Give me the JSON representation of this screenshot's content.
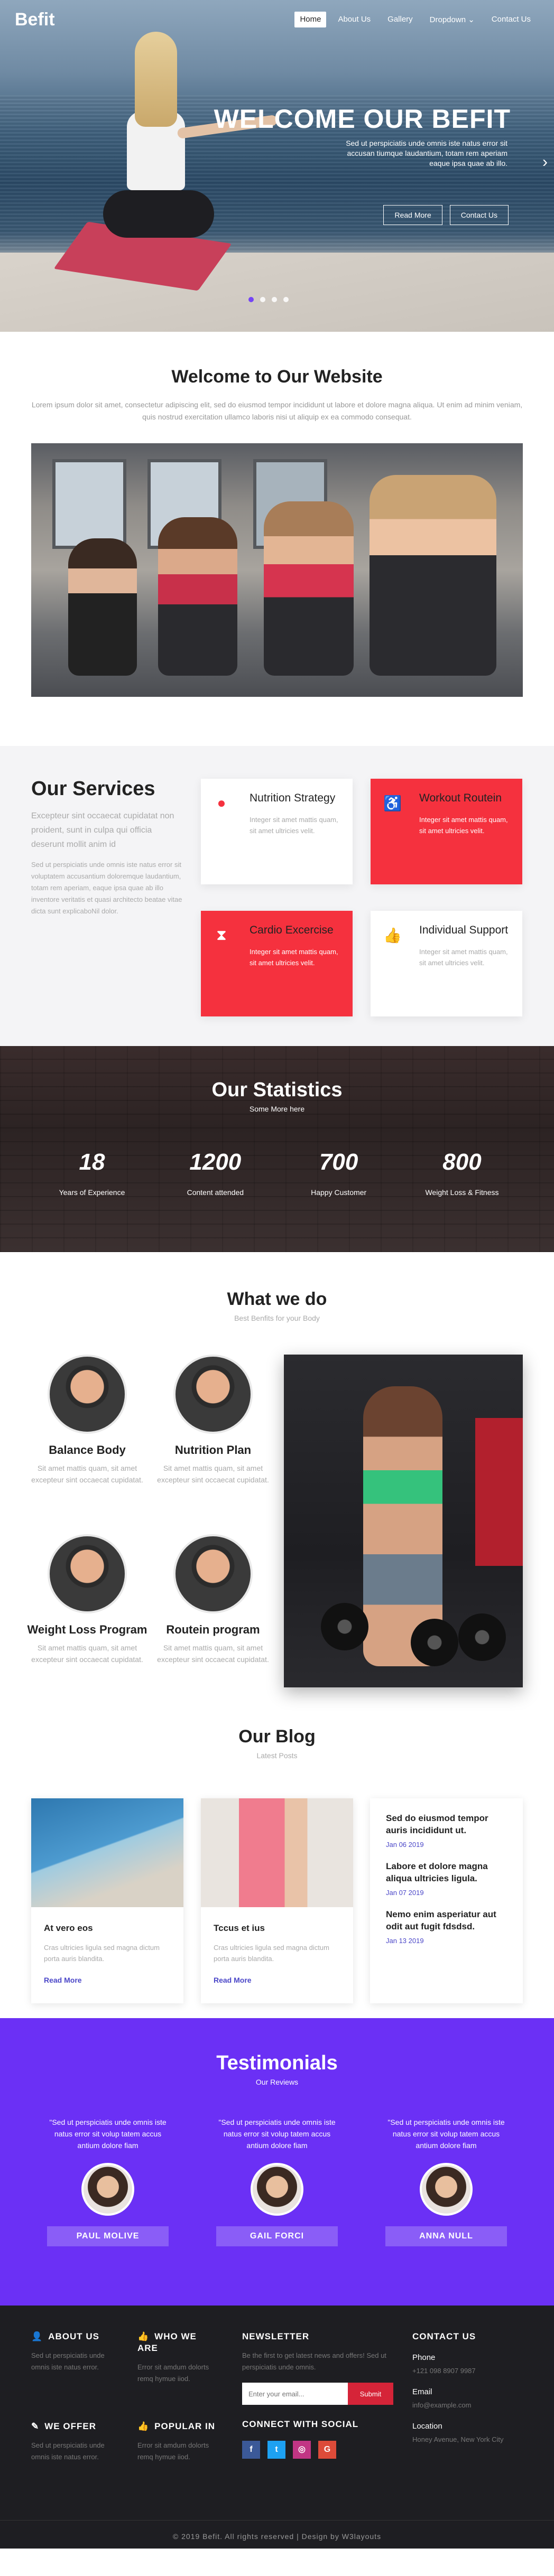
{
  "header": {
    "logo": "Befit",
    "nav": [
      "Home",
      "About Us",
      "Gallery",
      "Dropdown",
      "Contact Us"
    ],
    "dropdown_icon": "chevron-down-icon"
  },
  "hero": {
    "title": "WELCOME OUR BEFIT",
    "text": "Sed ut perspiciatis unde omnis iste natus error sit accusan tiumque laudantium, totam rem aperiam eaque ipsa quae ab illo.",
    "btn1": "Read More",
    "btn2": "Contact Us",
    "arrow_icon": "chevron-right-icon",
    "slides": 4
  },
  "welcome": {
    "title": "Welcome to Our Website",
    "text": "Lorem ipsum dolor sit amet, consectetur adipiscing elit, sed do eiusmod tempor incididunt ut labore et dolore magna aliqua. Ut enim ad minim veniam, quis nostrud exercitation ullamco laboris nisi ut aliquip ex ea commodo consequat."
  },
  "services": {
    "title": "Our Services",
    "lead": "Excepteur sint occaecat cupidatat non proident, sunt in culpa qui officia deserunt mollit anim id",
    "body": "Sed ut perspiciatis unde omnis iste natus error sit voluptatem accusantium doloremque laudantium, totam rem aperiam, eaque ipsa quae ab illo inventore veritatis et quasi architecto beatae vitae dicta sunt explicaboNil dolor.",
    "cards": [
      {
        "title": "Nutrition Strategy",
        "text": "Integer sit amet mattis quam, sit amet ultricies velit.",
        "icon": "apple-icon"
      },
      {
        "title": "Workout Routein",
        "text": "Integer sit amet mattis quam, sit amet ultricies velit.",
        "icon": "wheelchair-icon"
      },
      {
        "title": "Cardio Excercise",
        "text": "Integer sit amet mattis quam, sit amet ultricies velit.",
        "icon": "hourglass-icon"
      },
      {
        "title": "Individual Support",
        "text": "Integer sit amet mattis quam, sit amet ultricies velit.",
        "icon": "thumbs-up-icon"
      }
    ]
  },
  "stats": {
    "title": "Our Statistics",
    "sub": "Some More here",
    "items": [
      {
        "num": "18",
        "label": "Years of Experience"
      },
      {
        "num": "1200",
        "label": "Content attended"
      },
      {
        "num": "700",
        "label": "Happy Customer"
      },
      {
        "num": "800",
        "label": "Weight Loss & Fitness"
      }
    ]
  },
  "what": {
    "title": "What we do",
    "sub": "Best Benfits for your Body",
    "items": [
      {
        "title": "Balance Body",
        "text": "Sit amet mattis quam, sit amet excepteur sint occaecat cupidatat."
      },
      {
        "title": "Nutrition Plan",
        "text": "Sit amet mattis quam, sit amet excepteur sint occaecat cupidatat."
      },
      {
        "title": "Weight Loss Program",
        "text": "Sit amet mattis quam, sit amet excepteur sint occaecat cupidatat."
      },
      {
        "title": "Routein program",
        "text": "Sit amet mattis quam, sit amet excepteur sint occaecat cupidatat."
      }
    ]
  },
  "blog": {
    "title": "Our Blog",
    "sub": "Latest Posts",
    "cards": [
      {
        "title": "At vero eos",
        "text": "Cras ultricies ligula sed magna dictum porta auris blandita.",
        "more": "Read More"
      },
      {
        "title": "Tccus et ius",
        "text": "Cras ultricies ligula sed magna dictum porta auris blandita.",
        "more": "Read More"
      }
    ],
    "list": [
      {
        "title": "Sed do eiusmod tempor auris incididunt ut.",
        "date": "Jan 06 2019"
      },
      {
        "title": "Labore et dolore magna aliqua ultricies ligula.",
        "date": "Jan 07 2019"
      },
      {
        "title": "Nemo enim asperiatur aut odit aut fugit fdsdsd.",
        "date": "Jan 13 2019"
      }
    ]
  },
  "testimonials": {
    "title": "Testimonials",
    "sub": "Our Reviews",
    "items": [
      {
        "quote": "\"Sed ut perspiciatis unde omnis iste natus error sit volup tatem accus antium dolore fiam",
        "name": "PAUL MOLIVE"
      },
      {
        "quote": "\"Sed ut perspiciatis unde omnis iste natus error sit volup tatem accus antium dolore fiam",
        "name": "GAIL FORCI"
      },
      {
        "quote": "\"Sed ut perspiciatis unde omnis iste natus error sit volup tatem accus antium dolore fiam",
        "name": "ANNA NULL"
      }
    ]
  },
  "footer": {
    "about": {
      "title": "ABOUT US",
      "text": "Sed ut perspiciatis unde omnis iste natus error.",
      "icon": "user-icon"
    },
    "who": {
      "title": "WHO WE ARE",
      "text": "Error sit amdum dolorts remq hymue iiod.",
      "icon": "thumbs-up-icon"
    },
    "offer": {
      "title": "WE OFFER",
      "text": "Sed ut perspiciatis unde omnis iste natus error.",
      "icon": "pencil-icon"
    },
    "popular": {
      "title": "POPULAR IN",
      "text": "Error sit amdum dolorts remq hymue iiod.",
      "icon": "thumbs-up-icon"
    },
    "newsletter": {
      "title": "NEWSLETTER",
      "text": "Be the first to get latest news and offers! Sed ut perspiciatis unde omnis.",
      "placeholder": "Enter your email...",
      "button": "Submit"
    },
    "social_title": "CONNECT WITH SOCIAL",
    "social": [
      {
        "glyph": "f",
        "icon": "facebook-icon",
        "color": "#3b5998"
      },
      {
        "glyph": "t",
        "icon": "twitter-icon",
        "color": "#1da1f2"
      },
      {
        "glyph": "◎",
        "icon": "instagram-icon",
        "color": "#c13584"
      },
      {
        "glyph": "G",
        "icon": "google-plus-icon",
        "color": "#dd4b39"
      }
    ],
    "contact": {
      "title": "CONTACT US",
      "phone_label": "Phone",
      "phone": "+121 098 8907 9987",
      "email_label": "Email",
      "email": "info@example.com",
      "location_label": "Location",
      "location": "Honey Avenue, New York City"
    },
    "copyright": "© 2019 Befit. All rights reserved | Design by W3layouts"
  },
  "colors": {
    "accent": "#7444f6",
    "red": "#f5313e",
    "purple": "#6b30f5",
    "dark": "#1e1e22"
  }
}
